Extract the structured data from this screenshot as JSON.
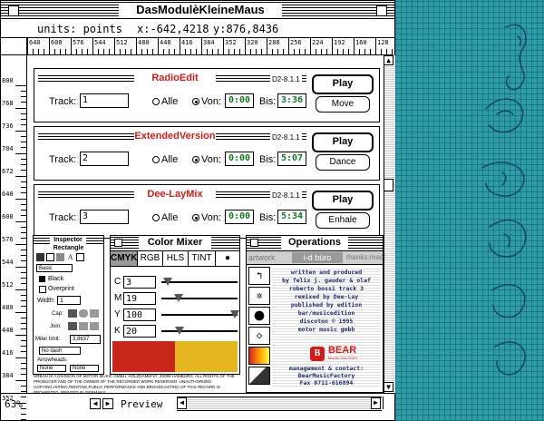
{
  "window": {
    "title": "DasModulèKleineMaus"
  },
  "units_bar": {
    "units_label": "units: points",
    "x_label": "x:-642,4218",
    "y_label": "y:876,8436"
  },
  "ruler": {
    "horizontal": [
      "640",
      "608",
      "576",
      "544",
      "512",
      "480",
      "448",
      "416",
      "384",
      "352",
      "320",
      "288",
      "256",
      "224",
      "192",
      "160",
      "128"
    ],
    "vertical": [
      "800",
      "768",
      "736",
      "704",
      "672",
      "640",
      "608",
      "576",
      "544",
      "512",
      "480",
      "448",
      "416",
      "384",
      "352"
    ]
  },
  "tracks": [
    {
      "title": "RadioEdit",
      "version": "D2-8.1.1",
      "track_label": "Track:",
      "track_value": "1",
      "opt_alle": "Alle",
      "opt_von": "Von:",
      "von_value": "0:00",
      "bis_label": "Bis:",
      "bis_value": "3:36",
      "play_label": "Play",
      "action_label": "Move"
    },
    {
      "title": "ExtendedVersion",
      "version": "D2-8.1.1",
      "track_label": "Track:",
      "track_value": "2",
      "opt_alle": "Alle",
      "opt_von": "Von:",
      "von_value": "0:00",
      "bis_label": "Bis:",
      "bis_value": "5:07",
      "play_label": "Play",
      "action_label": "Dance"
    },
    {
      "title": "Dee-LayMix",
      "version": "D2-8.1.1",
      "track_label": "Track:",
      "track_value": "3",
      "opt_alle": "Alle",
      "opt_von": "Von:",
      "von_value": "0:00",
      "bis_label": "Bis:",
      "bis_value": "5:34",
      "play_label": "Play",
      "action_label": "Enhale"
    }
  ],
  "inspector": {
    "title": "Inspector",
    "shape_label": "Rectangle",
    "style_value": "Basic",
    "fill_label": "Black",
    "overprint_label": "Overprint",
    "width_label": "Width:",
    "width_value": "1",
    "cap_label": "Cap:",
    "join_label": "Join:",
    "miter_label": "Miter limit:",
    "miter_value": "3,8637",
    "dash_value": "No dash",
    "arrowheads_label": "Arrowheads:",
    "arrow_left": "None",
    "arrow_right": "None"
  },
  "color_mixer": {
    "title": "Color Mixer",
    "tabs": [
      "CMYK",
      "RGB",
      "HLS",
      "TINT"
    ],
    "channels": [
      {
        "label": "C",
        "value": "3",
        "pos": 3
      },
      {
        "label": "M",
        "value": "19",
        "pos": 19
      },
      {
        "label": "Y",
        "value": "100",
        "pos": 100
      },
      {
        "label": "K",
        "value": "20",
        "pos": 20
      }
    ],
    "swatch_left": "#c9261a",
    "swatch_right": "#e4b51f"
  },
  "operations": {
    "title": "Operations",
    "tabs": [
      "artwork",
      "i-d büro",
      "thanks:mac!"
    ],
    "credits": [
      "written and produced",
      "by felix j. gauder & olaf",
      "roberto bossi      track 3",
      "remixed by Dee-Lay",
      "published by edition",
      "bar/musicedition",
      "discoton      © 1995",
      "motor music gmbh"
    ],
    "logo_text": "BEAR",
    "logo_sub": "MUSIC FACTORY",
    "contact": [
      "management & contact:",
      "BearMusicFactory",
      "Fax 0711-616894"
    ]
  },
  "fine_print": "URBAN IS A DIVISION OF MOTOR MUSIC GMBH, HOLZDAMM 57, 20099 HAMBURG. ALL RIGHTS OF THE PRODUCER AND OF THE OWNER OF THE RECORDED WORK RESERVED. UNAUTHORIZED COPYING,HIRING,RENTING,PUBLIC PERFORMANCE AND BROADCASTING OF THIS RECORD IS PROHIBITED. PRINTED IN GERMANY.",
  "status": {
    "zoom": "63%",
    "view": "Preview"
  },
  "colors": {
    "accent_red": "#d11a1a",
    "time_green": "#0a7a1c",
    "cover_teal": "#2b9aa5"
  }
}
